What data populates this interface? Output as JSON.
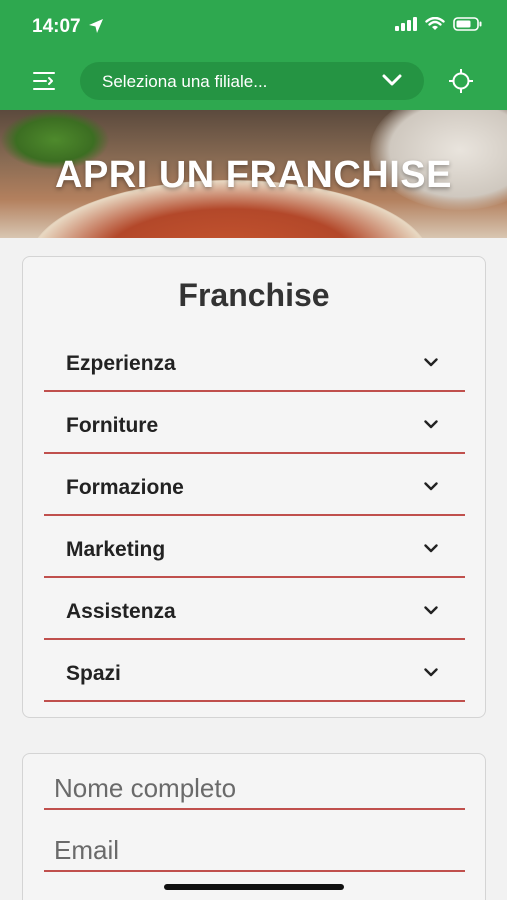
{
  "status": {
    "time": "14:07"
  },
  "nav": {
    "branch_select_label": "Seleziona una filiale..."
  },
  "hero": {
    "title": "APRI UN FRANCHISE"
  },
  "franchise": {
    "title": "Franchise",
    "items": [
      "Ezperienza",
      "Forniture",
      "Formazione",
      "Marketing",
      "Assistenza",
      "Spazi"
    ]
  },
  "form": {
    "name_placeholder": "Nome completo",
    "email_placeholder": "Email"
  },
  "colors": {
    "brand_green": "#2ea84f",
    "accent_red": "#c0504d"
  }
}
